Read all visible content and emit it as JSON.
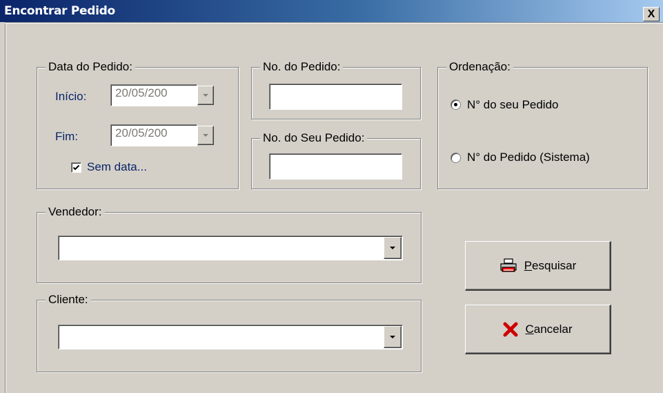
{
  "window": {
    "title": "Encontrar Pedido",
    "close_glyph": "X"
  },
  "date_group": {
    "legend": "Data do Pedido:",
    "inicio_label": "Início:",
    "inicio_value": "20/05/200",
    "fim_label": "Fim:",
    "fim_value": "20/05/200",
    "sem_data_label": "Sem data...",
    "sem_data_checked": true
  },
  "order_no_group": {
    "legend": "No. do Pedido:",
    "value": ""
  },
  "your_order_group": {
    "legend": "No. do Seu Pedido:",
    "value": ""
  },
  "sort_group": {
    "legend": "Ordenação:",
    "options": [
      {
        "label": "N° do seu Pedido",
        "selected": true
      },
      {
        "label": "N° do Pedido (Sistema)",
        "selected": false
      }
    ]
  },
  "seller_group": {
    "legend": "Vendedor:",
    "value": ""
  },
  "client_group": {
    "legend": "Cliente:",
    "value": ""
  },
  "buttons": {
    "search": {
      "accel": "P",
      "rest": "esquisar",
      "icon": "printer-icon"
    },
    "cancel": {
      "accel": "C",
      "rest": "ancelar",
      "icon": "red-x-icon"
    }
  },
  "colors": {
    "titlebar_start": "#0a246a",
    "titlebar_end": "#a6caf0",
    "face": "#d4d0c8",
    "cancel_icon": "#cc0000"
  }
}
